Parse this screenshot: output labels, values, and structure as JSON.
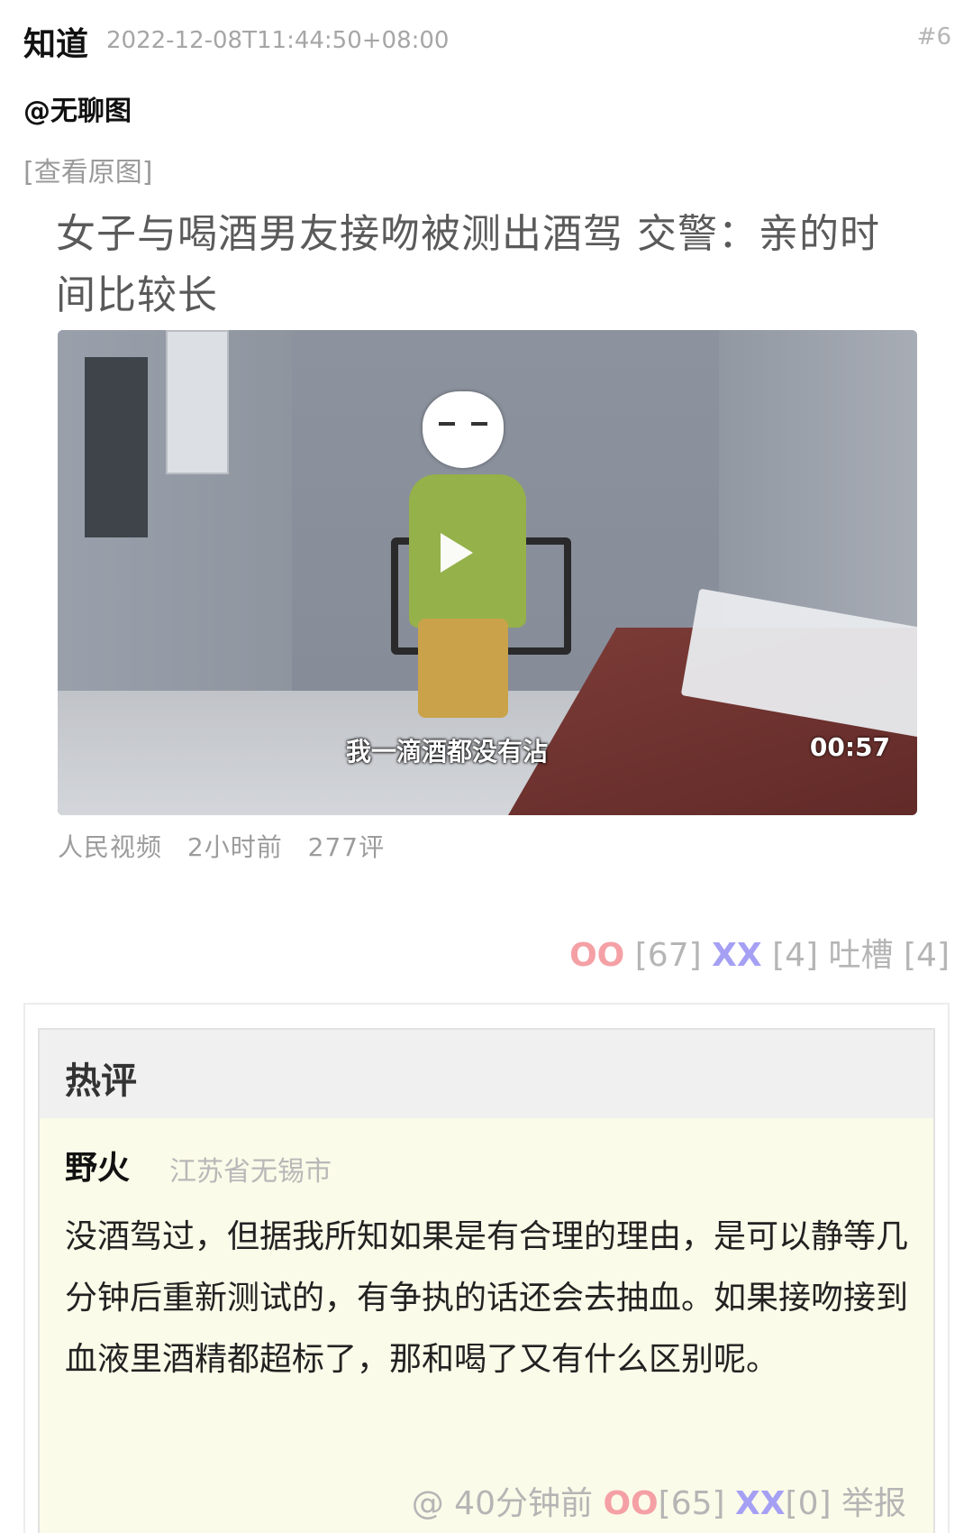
{
  "post": {
    "author": "知道",
    "timestamp": "2022-12-08T11:44:50+08:00",
    "number": "#6",
    "mention": "@无聊图",
    "view_original": "[查看原图]"
  },
  "news": {
    "title": "女子与喝酒男友接吻被测出酒驾 交警：亲的时间比较长",
    "video": {
      "subtitle": "我一滴酒都没有沾",
      "duration": "00:57"
    },
    "source": "人民视频",
    "time": "2小时前",
    "comments": "277评"
  },
  "votes": {
    "oo_label": "OO",
    "oo_count": "[67]",
    "xx_label": "XX",
    "xx_count": "[4]",
    "tucao_label": "吐槽",
    "tucao_count": "[4]"
  },
  "hot_comment": {
    "section_title": "热评",
    "author": "野火",
    "location": "江苏省无锡市",
    "text": "没酒驾过，但据我所知如果是有合理的理由，是可以静等几分钟后重新测试的，有争执的话还会去抽血。如果接吻接到血液里酒精都超标了，那和喝了又有什么区别呢。",
    "reply_symbol": "@",
    "time": "40分钟前",
    "oo_label": "OO",
    "oo_count": "[65]",
    "xx_label": "XX",
    "xx_count": "[0]",
    "report_label": "举报"
  },
  "colors": {
    "oo": "#f4a0a5",
    "xx": "#a6a0f4",
    "muted": "#b5b5b5",
    "hot_bg": "#fbfbe9"
  }
}
